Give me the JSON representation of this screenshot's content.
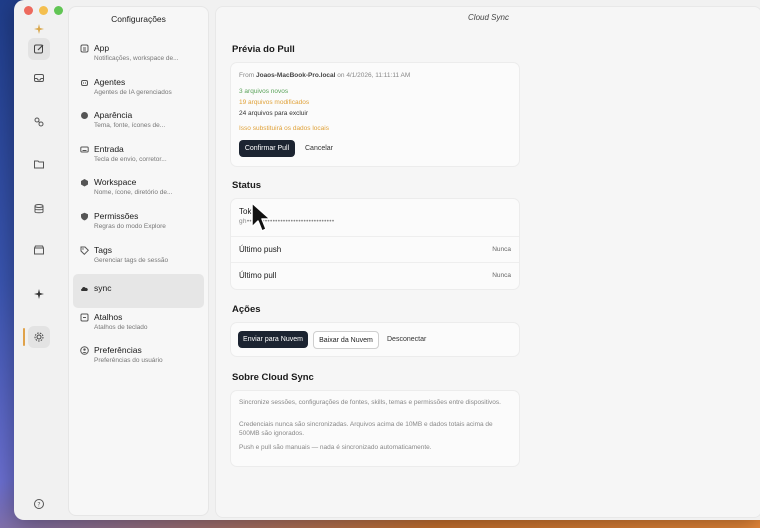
{
  "window": {
    "title": "Cloud Sync"
  },
  "rail": {
    "icons": [
      "compose-icon",
      "inbox-icon",
      "agents-icon",
      "folder-icon",
      "database-icon",
      "store-icon",
      "sparkle-icon",
      "settings-icon",
      "help-icon"
    ]
  },
  "settings": {
    "title": "Configurações",
    "items": [
      {
        "label": "App",
        "sub": "Notificações, workspace de..."
      },
      {
        "label": "Agentes",
        "sub": "Agentes de IA gerenciados"
      },
      {
        "label": "Aparência",
        "sub": "Tema, fonte, ícones de..."
      },
      {
        "label": "Entrada",
        "sub": "Tecla de envio, corretor..."
      },
      {
        "label": "Workspace",
        "sub": "Nome, ícone, diretório de..."
      },
      {
        "label": "Permissões",
        "sub": "Regras do modo Explore"
      },
      {
        "label": "Tags",
        "sub": "Gerenciar tags de sessão"
      },
      {
        "label": "sync",
        "sub": ""
      },
      {
        "label": "Atalhos",
        "sub": "Atalhos de teclado"
      },
      {
        "label": "Preferências",
        "sub": "Preferências do usuário"
      }
    ]
  },
  "pull_preview": {
    "title": "Prévia do Pull",
    "from_prefix": "From",
    "host": "Joaos-MacBook-Pro.local",
    "on": "on",
    "date": "4/1/2026, 11:11:11 AM",
    "new_files": "3 arquivos novos",
    "modified_files": "19 arquivos modificados",
    "delete_files": "24 arquivos para excluir",
    "warning": "Isso substituirá os dados locais",
    "confirm_label": "Confirmar Pull",
    "cancel_label": "Cancelar",
    "colors": {
      "new": "#5aa35a",
      "modified": "#e0a23a",
      "warning": "#e0a23a"
    }
  },
  "status": {
    "title": "Status",
    "token_label": "Tok",
    "token_value": "gh••••••••••••••••••••••••••••••••••",
    "last_push_label": "Último push",
    "last_push_value": "Nunca",
    "last_pull_label": "Último pull",
    "last_pull_value": "Nunca"
  },
  "actions": {
    "title": "Ações",
    "push_label": "Enviar para Nuvem",
    "pull_label": "Baixar da Nuvem",
    "disconnect_label": "Desconectar"
  },
  "about": {
    "title": "Sobre Cloud Sync",
    "p1": "Sincronize sessões, configurações de fontes, skills, temas e permissões entre dispositivos.",
    "p2": "Credenciais nunca são sincronizadas. Arquivos acima de 10MB e dados totais acima de 500MB são ignorados.",
    "p3": "Push e pull são manuais — nada é sincronizado automaticamente."
  }
}
